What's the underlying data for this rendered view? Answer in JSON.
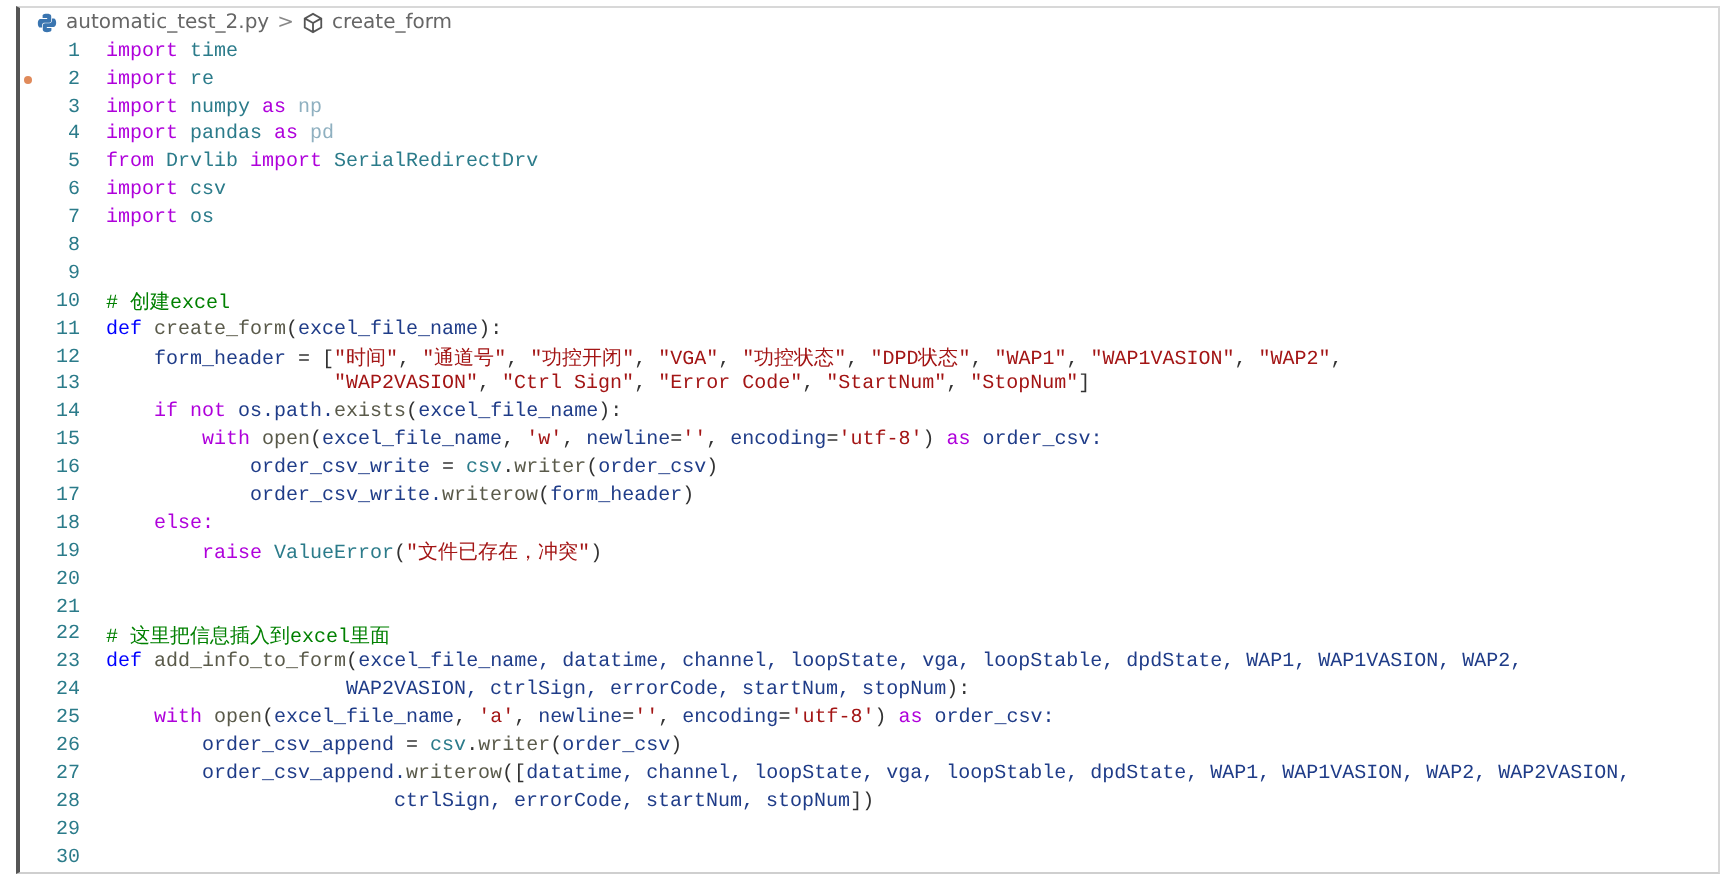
{
  "breadcrumb": {
    "file": "automatic_test_2.py",
    "separator": ">",
    "symbol": "create_form"
  },
  "lines": [
    {
      "number": "1",
      "modified": false,
      "tokens": [
        {
          "kind": "kw",
          "text": "import"
        },
        {
          "kind": "mod",
          "text": " time"
        }
      ]
    },
    {
      "number": "2",
      "modified": true,
      "tokens": [
        {
          "kind": "kw",
          "text": "import"
        },
        {
          "kind": "mod",
          "text": " re"
        }
      ]
    },
    {
      "number": "3",
      "modified": false,
      "tokens": [
        {
          "kind": "kw",
          "text": "import"
        },
        {
          "kind": "mod",
          "text": " numpy "
        },
        {
          "kind": "kw",
          "text": "as"
        },
        {
          "kind": "alias",
          "text": " np"
        }
      ]
    },
    {
      "number": "4",
      "modified": false,
      "tokens": [
        {
          "kind": "kw",
          "text": "import"
        },
        {
          "kind": "mod",
          "text": " pandas "
        },
        {
          "kind": "kw",
          "text": "as"
        },
        {
          "kind": "alias",
          "text": " pd"
        }
      ]
    },
    {
      "number": "5",
      "modified": false,
      "tokens": [
        {
          "kind": "kw",
          "text": "from"
        },
        {
          "kind": "mod",
          "text": " Drvlib "
        },
        {
          "kind": "kw",
          "text": "import"
        },
        {
          "kind": "mod",
          "text": " SerialRedirectDrv"
        }
      ]
    },
    {
      "number": "6",
      "modified": false,
      "tokens": [
        {
          "kind": "kw",
          "text": "import"
        },
        {
          "kind": "mod",
          "text": " csv"
        }
      ]
    },
    {
      "number": "7",
      "modified": false,
      "tokens": [
        {
          "kind": "kw",
          "text": "import"
        },
        {
          "kind": "mod",
          "text": " os"
        }
      ]
    },
    {
      "number": "8",
      "modified": false
    },
    {
      "number": "9",
      "modified": false
    },
    {
      "number": "10",
      "modified": false,
      "tokens": [
        {
          "kind": "comment",
          "text": "# 创建excel"
        }
      ]
    },
    {
      "number": "11",
      "modified": false,
      "tokens": [
        {
          "kind": "def",
          "text": "def"
        },
        {
          "kind": "fn",
          "text": " create_form"
        },
        {
          "kind": "punc",
          "text": "("
        },
        {
          "kind": "var",
          "text": "excel_file_name"
        },
        {
          "kind": "punc",
          "text": "):"
        }
      ]
    },
    {
      "number": "12",
      "modified": false,
      "tokens": [
        {
          "kind": "var",
          "text": "    form_header"
        },
        {
          "kind": "punc",
          "text": " = ["
        },
        {
          "kind": "str",
          "text": "\"时间\""
        },
        {
          "kind": "punc",
          "text": ", "
        },
        {
          "kind": "str",
          "text": "\"通道号\""
        },
        {
          "kind": "punc",
          "text": ", "
        },
        {
          "kind": "str",
          "text": "\"功控开闭\""
        },
        {
          "kind": "punc",
          "text": ", "
        },
        {
          "kind": "str",
          "text": "\"VGA\""
        },
        {
          "kind": "punc",
          "text": ", "
        },
        {
          "kind": "str",
          "text": "\"功控状态\""
        },
        {
          "kind": "punc",
          "text": ", "
        },
        {
          "kind": "str",
          "text": "\"DPD状态\""
        },
        {
          "kind": "punc",
          "text": ", "
        },
        {
          "kind": "str",
          "text": "\"WAP1\""
        },
        {
          "kind": "punc",
          "text": ", "
        },
        {
          "kind": "str",
          "text": "\"WAP1VASION\""
        },
        {
          "kind": "punc",
          "text": ", "
        },
        {
          "kind": "str",
          "text": "\"WAP2\""
        },
        {
          "kind": "punc",
          "text": ","
        }
      ]
    },
    {
      "number": "13",
      "modified": false,
      "tokens": [
        {
          "kind": "str",
          "text": "                   \"WAP2VASION\""
        },
        {
          "kind": "punc",
          "text": ", "
        },
        {
          "kind": "str",
          "text": "\"Ctrl Sign\""
        },
        {
          "kind": "punc",
          "text": ", "
        },
        {
          "kind": "str",
          "text": "\"Error Code\""
        },
        {
          "kind": "punc",
          "text": ", "
        },
        {
          "kind": "str",
          "text": "\"StartNum\""
        },
        {
          "kind": "punc",
          "text": ", "
        },
        {
          "kind": "str",
          "text": "\"StopNum\""
        },
        {
          "kind": "punc",
          "text": "]"
        }
      ]
    },
    {
      "number": "14",
      "modified": false,
      "tokens": [
        {
          "kind": "kw",
          "text": "    if not"
        },
        {
          "kind": "var",
          "text": " os.path."
        },
        {
          "kind": "fn",
          "text": "exists"
        },
        {
          "kind": "punc",
          "text": "("
        },
        {
          "kind": "var",
          "text": "excel_file_name"
        },
        {
          "kind": "punc",
          "text": "):"
        }
      ]
    },
    {
      "number": "15",
      "modified": false,
      "tokens": [
        {
          "kind": "kw",
          "text": "        with"
        },
        {
          "kind": "fn",
          "text": " open"
        },
        {
          "kind": "punc",
          "text": "("
        },
        {
          "kind": "var",
          "text": "excel_file_name"
        },
        {
          "kind": "punc",
          "text": ", "
        },
        {
          "kind": "str",
          "text": "'w'"
        },
        {
          "kind": "punc",
          "text": ", "
        },
        {
          "kind": "var",
          "text": "newline"
        },
        {
          "kind": "punc",
          "text": "="
        },
        {
          "kind": "str",
          "text": "''"
        },
        {
          "kind": "punc",
          "text": ", "
        },
        {
          "kind": "var",
          "text": "encoding"
        },
        {
          "kind": "punc",
          "text": "="
        },
        {
          "kind": "str",
          "text": "'utf-8'"
        },
        {
          "kind": "punc",
          "text": ") "
        },
        {
          "kind": "kw",
          "text": "as"
        },
        {
          "kind": "var",
          "text": " order_csv:"
        }
      ]
    },
    {
      "number": "16",
      "modified": false,
      "tokens": [
        {
          "kind": "var",
          "text": "            order_csv_write"
        },
        {
          "kind": "punc",
          "text": " = "
        },
        {
          "kind": "mod",
          "text": "csv"
        },
        {
          "kind": "punc",
          "text": "."
        },
        {
          "kind": "fn",
          "text": "writer"
        },
        {
          "kind": "punc",
          "text": "("
        },
        {
          "kind": "var",
          "text": "order_csv"
        },
        {
          "kind": "punc",
          "text": ")"
        }
      ]
    },
    {
      "number": "17",
      "modified": false,
      "tokens": [
        {
          "kind": "var",
          "text": "            order_csv_write."
        },
        {
          "kind": "fn",
          "text": "writerow"
        },
        {
          "kind": "punc",
          "text": "("
        },
        {
          "kind": "var",
          "text": "form_header"
        },
        {
          "kind": "punc",
          "text": ")"
        }
      ]
    },
    {
      "number": "18",
      "modified": false,
      "tokens": [
        {
          "kind": "kw",
          "text": "    else:"
        }
      ]
    },
    {
      "number": "19",
      "modified": false,
      "tokens": [
        {
          "kind": "kw",
          "text": "        raise"
        },
        {
          "kind": "mod",
          "text": " ValueError"
        },
        {
          "kind": "punc",
          "text": "("
        },
        {
          "kind": "str",
          "text": "\"文件已存在，冲突\""
        },
        {
          "kind": "punc",
          "text": ")"
        }
      ]
    },
    {
      "number": "20",
      "modified": false
    },
    {
      "number": "21",
      "modified": false
    },
    {
      "number": "22",
      "modified": false,
      "tokens": [
        {
          "kind": "comment",
          "text": "# 这里把信息插入到excel里面"
        }
      ]
    },
    {
      "number": "23",
      "modified": false,
      "tokens": [
        {
          "kind": "def",
          "text": "def"
        },
        {
          "kind": "fn",
          "text": " add_info_to_form"
        },
        {
          "kind": "punc",
          "text": "("
        },
        {
          "kind": "var",
          "text": "excel_file_name, datatime, channel, loopState, vga, loopStable, dpdState, WAP1, WAP1VASION, WAP2,"
        }
      ]
    },
    {
      "number": "24",
      "modified": false,
      "tokens": [
        {
          "kind": "var",
          "text": "                    WAP2VASION, ctrlSign, errorCode, startNum, stopNum"
        },
        {
          "kind": "punc",
          "text": "):"
        }
      ]
    },
    {
      "number": "25",
      "modified": false,
      "tokens": [
        {
          "kind": "kw",
          "text": "    with"
        },
        {
          "kind": "fn",
          "text": " open"
        },
        {
          "kind": "punc",
          "text": "("
        },
        {
          "kind": "var",
          "text": "excel_file_name"
        },
        {
          "kind": "punc",
          "text": ", "
        },
        {
          "kind": "str",
          "text": "'a'"
        },
        {
          "kind": "punc",
          "text": ", "
        },
        {
          "kind": "var",
          "text": "newline"
        },
        {
          "kind": "punc",
          "text": "="
        },
        {
          "kind": "str",
          "text": "''"
        },
        {
          "kind": "punc",
          "text": ", "
        },
        {
          "kind": "var",
          "text": "encoding"
        },
        {
          "kind": "punc",
          "text": "="
        },
        {
          "kind": "str",
          "text": "'utf-8'"
        },
        {
          "kind": "punc",
          "text": ") "
        },
        {
          "kind": "kw",
          "text": "as"
        },
        {
          "kind": "var",
          "text": " order_csv:"
        }
      ]
    },
    {
      "number": "26",
      "modified": false,
      "tokens": [
        {
          "kind": "var",
          "text": "        order_csv_append"
        },
        {
          "kind": "punc",
          "text": " = "
        },
        {
          "kind": "mod",
          "text": "csv"
        },
        {
          "kind": "punc",
          "text": "."
        },
        {
          "kind": "fn",
          "text": "writer"
        },
        {
          "kind": "punc",
          "text": "("
        },
        {
          "kind": "var",
          "text": "order_csv"
        },
        {
          "kind": "punc",
          "text": ")"
        }
      ]
    },
    {
      "number": "27",
      "modified": false,
      "tokens": [
        {
          "kind": "var",
          "text": "        order_csv_append."
        },
        {
          "kind": "fn",
          "text": "writerow"
        },
        {
          "kind": "punc",
          "text": "(["
        },
        {
          "kind": "var",
          "text": "datatime, channel, loopState, vga, loopStable, dpdState, WAP1, WAP1VASION, WAP2, WAP2VASION,"
        }
      ]
    },
    {
      "number": "28",
      "modified": false,
      "tokens": [
        {
          "kind": "var",
          "text": "                        ctrlSign, errorCode, startNum, stopNum"
        },
        {
          "kind": "punc",
          "text": "])"
        }
      ]
    },
    {
      "number": "29",
      "modified": false
    },
    {
      "number": "30",
      "modified": false
    }
  ]
}
